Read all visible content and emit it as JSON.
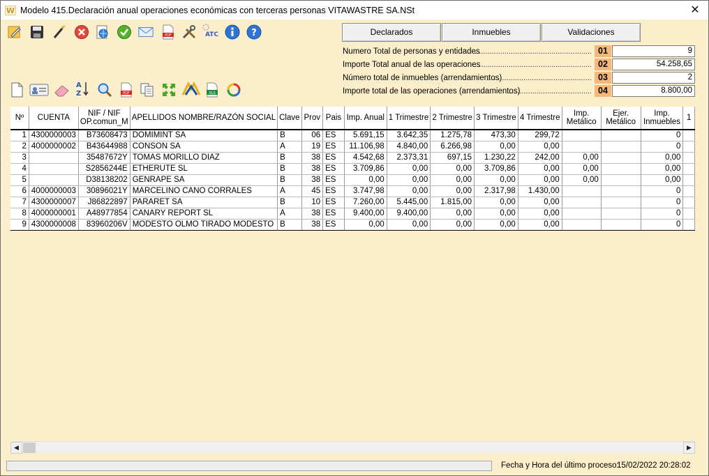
{
  "window": {
    "title": "Modelo 415.Declaración anual operaciones económicas con terceras personas VITAWASTRE SA.NSt",
    "close_glyph": "✕"
  },
  "toolbar1": [
    {
      "name": "edit-note-icon"
    },
    {
      "name": "save-icon"
    },
    {
      "name": "magic-wand-icon"
    },
    {
      "name": "cancel-icon"
    },
    {
      "name": "web-document-icon"
    },
    {
      "name": "validate-check-icon"
    },
    {
      "name": "email-icon"
    },
    {
      "name": "pdf-icon"
    },
    {
      "name": "tools-icon"
    },
    {
      "name": "atc-icon",
      "label": "ATC"
    },
    {
      "name": "info-icon"
    },
    {
      "name": "help-icon"
    }
  ],
  "toolbar2": [
    {
      "name": "new-document-icon"
    },
    {
      "name": "id-card-icon"
    },
    {
      "name": "eraser-icon"
    },
    {
      "name": "sort-az-icon"
    },
    {
      "name": "search-icon"
    },
    {
      "name": "pdf-icon"
    },
    {
      "name": "copy-documents-icon"
    },
    {
      "name": "expand-icon"
    },
    {
      "name": "aeat-logo-icon"
    },
    {
      "name": "excel-icon"
    },
    {
      "name": "refresh-icon"
    }
  ],
  "tabs": {
    "declarados": "Declarados",
    "inmuebles": "Inmuebles",
    "validaciones": "Validaciones"
  },
  "summary": [
    {
      "label": "Numero Total de personas y entidades",
      "num": "01",
      "value": "9"
    },
    {
      "label": "Importe Total anual de las operaciones",
      "num": "02",
      "value": "54.258,65"
    },
    {
      "label": "Número total de inmuebles (arrendamientos)",
      "num": "03",
      "value": "2"
    },
    {
      "label": "Importe total de las operaciones  (arrendamientos)",
      "num": "04",
      "value": "8.800,00"
    }
  ],
  "table": {
    "headers": {
      "n": "Nº",
      "cuenta": "CUENTA",
      "nif_1": "NIF / NIF",
      "nif_2": "OP.comun_M",
      "nombre": "APELLIDOS NOMBRE/RAZÓN SOCIAL",
      "clave": "Clave",
      "prov": "Prov",
      "pais": "Pais",
      "anual": "Imp. Anual",
      "t1": "1 Trimestre",
      "t2": "2 Trimestre",
      "t3": "3 Trimestre",
      "t4": "4 Trimestre",
      "metal_1": "Imp.",
      "metal_2": "Metálico",
      "ejer_1": "Ejer.",
      "ejer_2": "Metálico",
      "inm_1": "Imp.",
      "inm_2": "Inmuebles",
      "extra": "1"
    },
    "rows": [
      {
        "n": "1",
        "cuenta": "4300000003",
        "nif": "B73608473",
        "nombre": "DOMIMINT SA",
        "clave": "B",
        "prov": "06",
        "pais": "ES",
        "anual": "5.691,15",
        "t1": "3.642,35",
        "t2": "1.275,78",
        "t3": "473,30",
        "t4": "299,72",
        "metal": "",
        "ejer": "",
        "inm": "0"
      },
      {
        "n": "2",
        "cuenta": "4000000002",
        "nif": "B43644988",
        "nombre": "CONSON SA",
        "clave": "A",
        "prov": "19",
        "pais": "ES",
        "anual": "11.106,98",
        "t1": "4.840,00",
        "t2": "6.266,98",
        "t3": "0,00",
        "t4": "0,00",
        "metal": "",
        "ejer": "",
        "inm": "0"
      },
      {
        "n": "3",
        "cuenta": "",
        "nif": "35487672Y",
        "nombre": "TOMAS MORILLO DIAZ",
        "clave": "B",
        "prov": "38",
        "pais": "ES",
        "anual": "4.542,68",
        "t1": "2.373,31",
        "t2": "697,15",
        "t3": "1.230,22",
        "t4": "242,00",
        "metal": "0,00",
        "ejer": "",
        "inm": "0,00"
      },
      {
        "n": "4",
        "cuenta": "",
        "nif": "S2856244E",
        "nombre": "ETHERUTE SL",
        "clave": "B",
        "prov": "38",
        "pais": "ES",
        "anual": "3.709,86",
        "t1": "0,00",
        "t2": "0,00",
        "t3": "3.709,86",
        "t4": "0,00",
        "metal": "0,00",
        "ejer": "",
        "inm": "0,00"
      },
      {
        "n": "5",
        "cuenta": "",
        "nif": "D38138202",
        "nombre": "GENRAPE SA",
        "clave": "B",
        "prov": "38",
        "pais": "ES",
        "anual": "0,00",
        "t1": "0,00",
        "t2": "0,00",
        "t3": "0,00",
        "t4": "0,00",
        "metal": "0,00",
        "ejer": "",
        "inm": "0,00"
      },
      {
        "n": "6",
        "cuenta": "4000000003",
        "nif": "30896021Y",
        "nombre": "MARCELINO CANO CORRALES",
        "clave": "A",
        "prov": "45",
        "pais": "ES",
        "anual": "3.747,98",
        "t1": "0,00",
        "t2": "0,00",
        "t3": "2.317,98",
        "t4": "1.430,00",
        "metal": "",
        "ejer": "",
        "inm": "0"
      },
      {
        "n": "7",
        "cuenta": "4300000007",
        "nif": "J86822897",
        "nombre": "PARARET SA",
        "clave": "B",
        "prov": "10",
        "pais": "ES",
        "anual": "7.260,00",
        "t1": "5.445,00",
        "t2": "1.815,00",
        "t3": "0,00",
        "t4": "0,00",
        "metal": "",
        "ejer": "",
        "inm": "0"
      },
      {
        "n": "8",
        "cuenta": "4000000001",
        "nif": "A48977854",
        "nombre": "CANARY REPORT SL",
        "clave": "A",
        "prov": "38",
        "pais": "ES",
        "anual": "9.400,00",
        "t1": "9.400,00",
        "t2": "0,00",
        "t3": "0,00",
        "t4": "0,00",
        "metal": "",
        "ejer": "",
        "inm": "0"
      },
      {
        "n": "9",
        "cuenta": "4300000008",
        "nif": "83960206V",
        "nombre": "MODESTO OLMO TIRADO MODESTO",
        "clave": "B",
        "prov": "38",
        "pais": "ES",
        "anual": "0,00",
        "t1": "0,00",
        "t2": "0,00",
        "t3": "0,00",
        "t4": "0,00",
        "metal": "",
        "ejer": "",
        "inm": "0"
      }
    ]
  },
  "scrollbar": {
    "left_arrow": "◀",
    "right_arrow": "▶"
  },
  "status": {
    "label": "Fecha y Hora del último proceso:",
    "value": "15/02/2022 20:28:02"
  }
}
